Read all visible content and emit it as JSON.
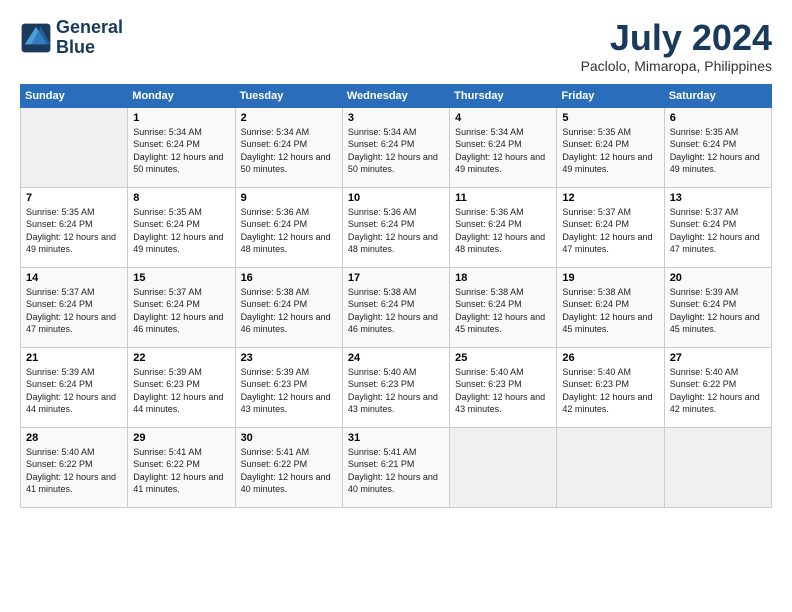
{
  "header": {
    "logo_line1": "General",
    "logo_line2": "Blue",
    "month_title": "July 2024",
    "location": "Paclolo, Mimaropa, Philippines"
  },
  "columns": [
    "Sunday",
    "Monday",
    "Tuesday",
    "Wednesday",
    "Thursday",
    "Friday",
    "Saturday"
  ],
  "weeks": [
    [
      {
        "day": "",
        "empty": true
      },
      {
        "day": "1",
        "sunrise": "5:34 AM",
        "sunset": "6:24 PM",
        "daylight": "12 hours and 50 minutes."
      },
      {
        "day": "2",
        "sunrise": "5:34 AM",
        "sunset": "6:24 PM",
        "daylight": "12 hours and 50 minutes."
      },
      {
        "day": "3",
        "sunrise": "5:34 AM",
        "sunset": "6:24 PM",
        "daylight": "12 hours and 50 minutes."
      },
      {
        "day": "4",
        "sunrise": "5:34 AM",
        "sunset": "6:24 PM",
        "daylight": "12 hours and 49 minutes."
      },
      {
        "day": "5",
        "sunrise": "5:35 AM",
        "sunset": "6:24 PM",
        "daylight": "12 hours and 49 minutes."
      },
      {
        "day": "6",
        "sunrise": "5:35 AM",
        "sunset": "6:24 PM",
        "daylight": "12 hours and 49 minutes."
      }
    ],
    [
      {
        "day": "7",
        "sunrise": "5:35 AM",
        "sunset": "6:24 PM",
        "daylight": "12 hours and 49 minutes."
      },
      {
        "day": "8",
        "sunrise": "5:35 AM",
        "sunset": "6:24 PM",
        "daylight": "12 hours and 49 minutes."
      },
      {
        "day": "9",
        "sunrise": "5:36 AM",
        "sunset": "6:24 PM",
        "daylight": "12 hours and 48 minutes."
      },
      {
        "day": "10",
        "sunrise": "5:36 AM",
        "sunset": "6:24 PM",
        "daylight": "12 hours and 48 minutes."
      },
      {
        "day": "11",
        "sunrise": "5:36 AM",
        "sunset": "6:24 PM",
        "daylight": "12 hours and 48 minutes."
      },
      {
        "day": "12",
        "sunrise": "5:37 AM",
        "sunset": "6:24 PM",
        "daylight": "12 hours and 47 minutes."
      },
      {
        "day": "13",
        "sunrise": "5:37 AM",
        "sunset": "6:24 PM",
        "daylight": "12 hours and 47 minutes."
      }
    ],
    [
      {
        "day": "14",
        "sunrise": "5:37 AM",
        "sunset": "6:24 PM",
        "daylight": "12 hours and 47 minutes."
      },
      {
        "day": "15",
        "sunrise": "5:37 AM",
        "sunset": "6:24 PM",
        "daylight": "12 hours and 46 minutes."
      },
      {
        "day": "16",
        "sunrise": "5:38 AM",
        "sunset": "6:24 PM",
        "daylight": "12 hours and 46 minutes."
      },
      {
        "day": "17",
        "sunrise": "5:38 AM",
        "sunset": "6:24 PM",
        "daylight": "12 hours and 46 minutes."
      },
      {
        "day": "18",
        "sunrise": "5:38 AM",
        "sunset": "6:24 PM",
        "daylight": "12 hours and 45 minutes."
      },
      {
        "day": "19",
        "sunrise": "5:38 AM",
        "sunset": "6:24 PM",
        "daylight": "12 hours and 45 minutes."
      },
      {
        "day": "20",
        "sunrise": "5:39 AM",
        "sunset": "6:24 PM",
        "daylight": "12 hours and 45 minutes."
      }
    ],
    [
      {
        "day": "21",
        "sunrise": "5:39 AM",
        "sunset": "6:24 PM",
        "daylight": "12 hours and 44 minutes."
      },
      {
        "day": "22",
        "sunrise": "5:39 AM",
        "sunset": "6:23 PM",
        "daylight": "12 hours and 44 minutes."
      },
      {
        "day": "23",
        "sunrise": "5:39 AM",
        "sunset": "6:23 PM",
        "daylight": "12 hours and 43 minutes."
      },
      {
        "day": "24",
        "sunrise": "5:40 AM",
        "sunset": "6:23 PM",
        "daylight": "12 hours and 43 minutes."
      },
      {
        "day": "25",
        "sunrise": "5:40 AM",
        "sunset": "6:23 PM",
        "daylight": "12 hours and 43 minutes."
      },
      {
        "day": "26",
        "sunrise": "5:40 AM",
        "sunset": "6:23 PM",
        "daylight": "12 hours and 42 minutes."
      },
      {
        "day": "27",
        "sunrise": "5:40 AM",
        "sunset": "6:22 PM",
        "daylight": "12 hours and 42 minutes."
      }
    ],
    [
      {
        "day": "28",
        "sunrise": "5:40 AM",
        "sunset": "6:22 PM",
        "daylight": "12 hours and 41 minutes."
      },
      {
        "day": "29",
        "sunrise": "5:41 AM",
        "sunset": "6:22 PM",
        "daylight": "12 hours and 41 minutes."
      },
      {
        "day": "30",
        "sunrise": "5:41 AM",
        "sunset": "6:22 PM",
        "daylight": "12 hours and 40 minutes."
      },
      {
        "day": "31",
        "sunrise": "5:41 AM",
        "sunset": "6:21 PM",
        "daylight": "12 hours and 40 minutes."
      },
      {
        "day": "",
        "empty": true
      },
      {
        "day": "",
        "empty": true
      },
      {
        "day": "",
        "empty": true
      }
    ]
  ]
}
